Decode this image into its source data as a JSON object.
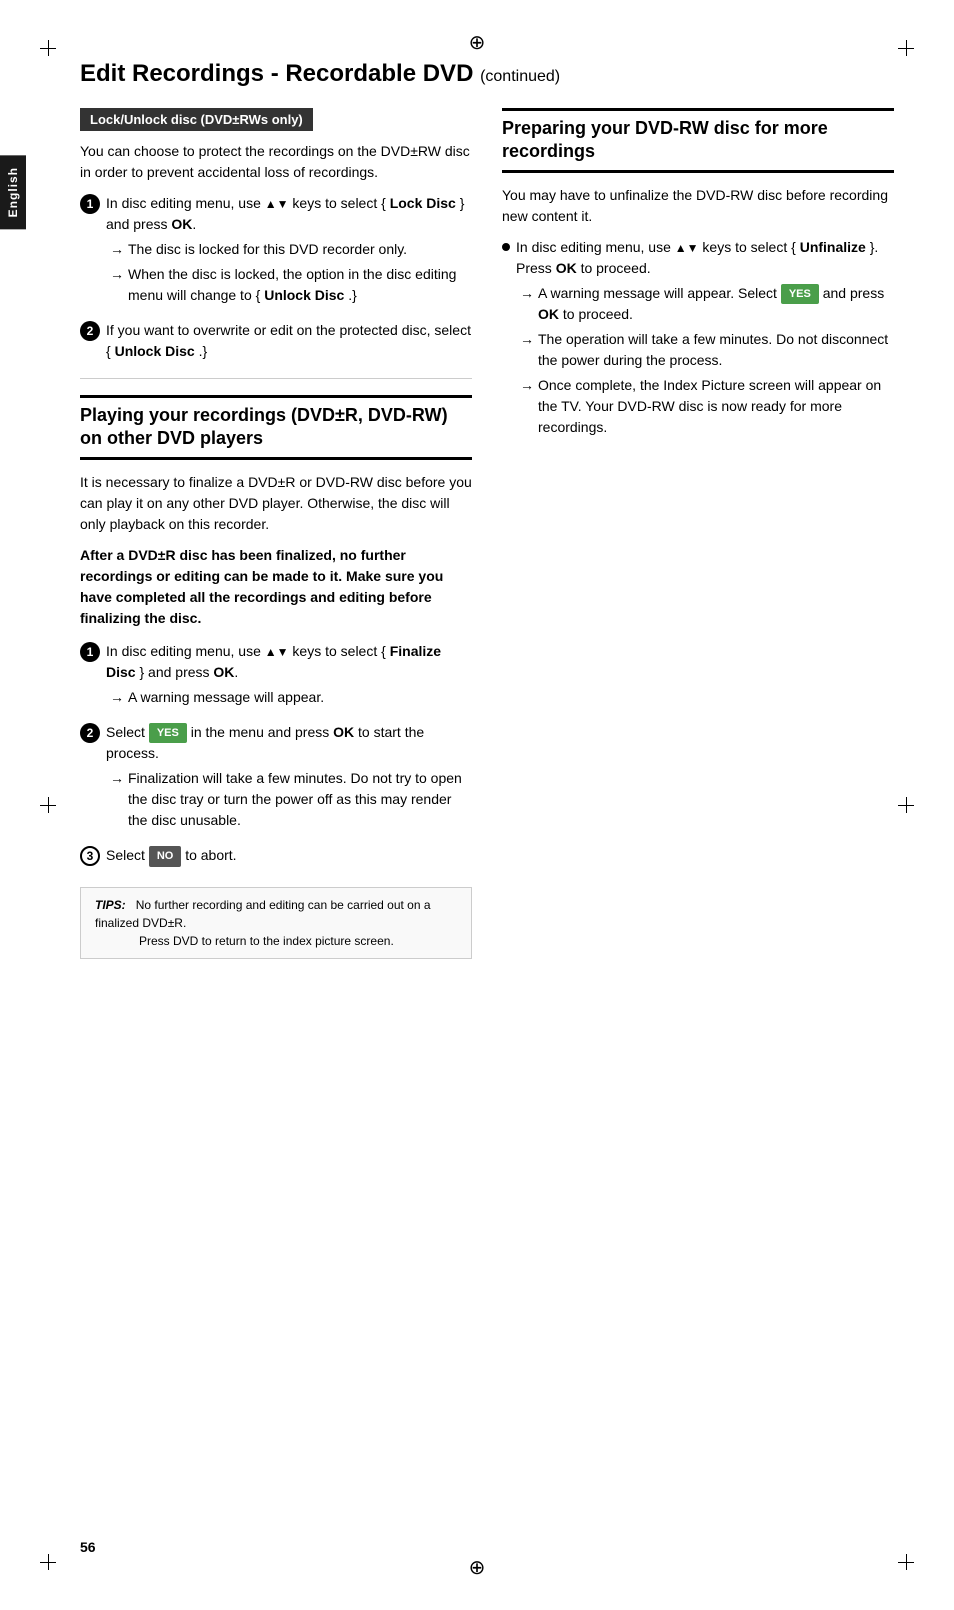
{
  "page": {
    "title": "Edit Recordings - Recordable DVD",
    "title_continued": "(continued)",
    "page_number": "56",
    "sidebar_label": "English"
  },
  "left_col": {
    "lock_section": {
      "box_label": "Lock/Unlock disc (DVD±RWs only)",
      "intro": "You can choose to protect the recordings on the DVD±RW disc in order to prevent accidental loss of recordings.",
      "step1": {
        "num": "1",
        "text_before": "In disc editing menu, use ",
        "arrows": "▲▼",
        "text_after": " keys to select { ",
        "bold1": "Lock Disc",
        "text_mid": " } and press ",
        "bold2": "OK",
        "text_end": ".",
        "arrow1": "The disc is locked for this DVD recorder only.",
        "arrow2": "When the disc is locked, the option in the disc editing menu will change to { ",
        "bold_unlock": "Unlock Disc",
        "arrow2_end": " .}"
      },
      "step2": {
        "num": "2",
        "text": "If you want to overwrite or edit on the protected disc, select { ",
        "bold": "Unlock Disc",
        "text_end": " .}"
      }
    },
    "playing_section": {
      "heading": "Playing your recordings (DVD±R, DVD-RW) on other DVD players",
      "intro": "It is necessary to finalize a DVD±R or DVD-RW disc before you can play it on any other DVD player. Otherwise, the disc will only playback on this recorder.",
      "warning": "After a DVD±R disc has been finalized, no further recordings or editing can be made to it. Make sure you have completed all the recordings and editing before finalizing the disc.",
      "step1": {
        "num": "1",
        "text_before": "In disc editing menu, use ",
        "arrows": "▲▼",
        "text_after": " keys to select { ",
        "bold1": "Finalize Disc",
        "text_mid": " } and press ",
        "bold2": "OK",
        "text_end": ".",
        "arrow1": "A warning message will appear."
      },
      "step2": {
        "num": "2",
        "text_before": "Select ",
        "btn_yes": "YES",
        "text_mid": " in the menu and press ",
        "bold_ok": "OK",
        "text_after": " to start the process.",
        "arrow1": "Finalization will take a few minutes. Do not try to open the disc tray or turn the power off as this may render the disc unusable."
      },
      "step3": {
        "num": "3",
        "text_before": "Select ",
        "btn_no": "NO",
        "text_after": " to abort."
      }
    },
    "tips": {
      "label": "TIPS:",
      "line1": "No further recording and editing can be carried out on a finalized DVD±R.",
      "line2": "Press DVD to return to the index picture screen."
    }
  },
  "right_col": {
    "section": {
      "heading": "Preparing your DVD-RW disc for more recordings",
      "intro": "You may have to unfinalize the DVD-RW disc before recording new content it.",
      "bullet": {
        "text_before": "In disc editing menu, use ",
        "arrows": "▲▼",
        "text_after": " keys to select { ",
        "bold1": "Unfinalize",
        "text_mid": " }. Press ",
        "bold2": "OK",
        "text_end": " to proceed.",
        "arrow1": "A warning message will appear. Select ",
        "btn_yes": "YES",
        "arrow1_end": " and press ",
        "arrow1_bold": "OK",
        "arrow1_final": " to proceed.",
        "arrow2": "The operation will take a few minutes. Do not disconnect the power during the process.",
        "arrow3": "Once complete, the Index Picture screen will appear on the TV. Your DVD-RW disc is now ready for more recordings."
      }
    }
  }
}
